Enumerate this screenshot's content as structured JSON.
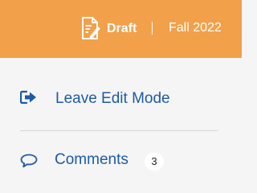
{
  "header": {
    "status": "Draft",
    "separator": "|",
    "term": "Fall 2022",
    "status_icon": "document-edit-icon",
    "background_color": "#f2a04a"
  },
  "menu": {
    "leave_edit": {
      "label": "Leave Edit Mode",
      "icon": "exit-icon"
    },
    "comments": {
      "label": "Comments",
      "icon": "speech-bubble-icon",
      "count": "3"
    },
    "link_color": "#1e5aa8"
  }
}
